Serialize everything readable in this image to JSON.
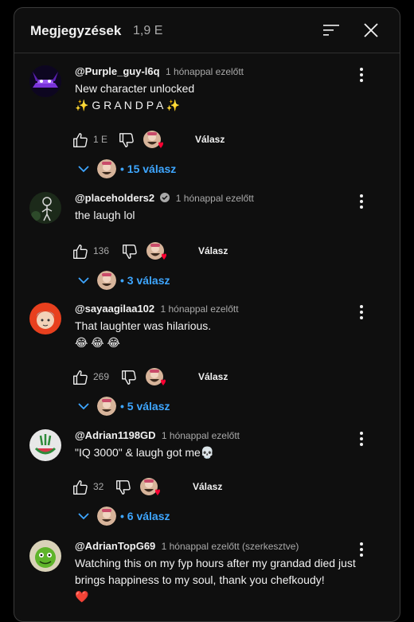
{
  "header": {
    "title": "Megjegyzések",
    "count": "1,9 E",
    "sort_icon": "sort-icon",
    "close_icon": "close-icon"
  },
  "comments": [
    {
      "author": "@Purple_guy-l6q",
      "verified": false,
      "time": "1 hónappal ezelőtt",
      "text": "New character unlocked\n✨ G R A N D P A ✨",
      "likes": "1 E",
      "reply_label": "Válasz",
      "replies": "• 15 válasz",
      "avatar": "purple-guy-avatar"
    },
    {
      "author": "@placeholders2",
      "verified": true,
      "time": "1 hónappal ezelőtt",
      "text": "the laugh lol",
      "likes": "136",
      "reply_label": "Válasz",
      "replies": "• 3 válasz",
      "avatar": "stick-figure-avatar"
    },
    {
      "author": "@sayaagilaa102",
      "verified": false,
      "time": "1 hónappal ezelőtt",
      "text": "That laughter was hilarious.\n😂 😂 😂",
      "likes": "269",
      "reply_label": "Válasz",
      "replies": "• 5 válasz",
      "avatar": "anime-character-avatar"
    },
    {
      "author": "@Adrian1198GD",
      "verified": false,
      "time": "1 hónappal ezelőtt",
      "text": "\"IQ 3000\" & laugh got me💀",
      "likes": "32",
      "reply_label": "Válasz",
      "replies": "• 6 válasz",
      "avatar": "watermelon-logo-avatar"
    },
    {
      "author": "@AdrianTopG69",
      "verified": false,
      "time": "1 hónappal ezelőtt (szerkesztve)",
      "text": "Watching this on my fyp hours after my grandad died just brings happiness to my soul, thank you chefkoudy!\n❤️",
      "avatar": "green-character-avatar"
    }
  ],
  "colors": {
    "background": "#0f0f0f",
    "link": "#3ea6ff",
    "heart": "#ff0033",
    "secondary_text": "#aaaaaa"
  }
}
